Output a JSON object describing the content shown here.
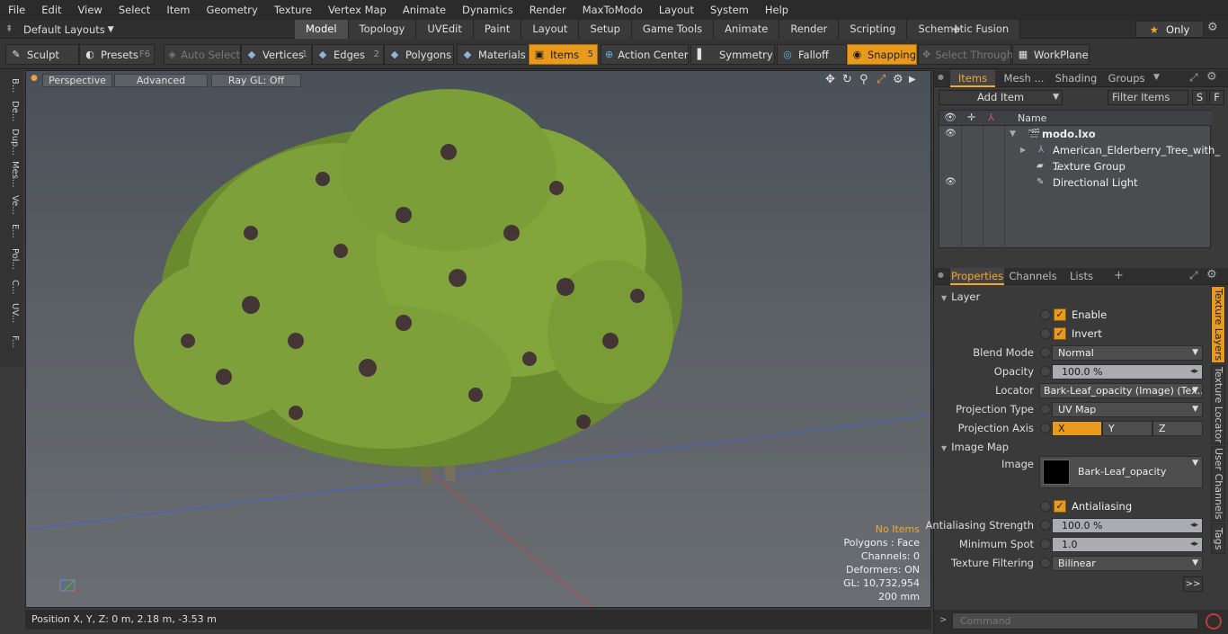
{
  "menu": [
    "File",
    "Edit",
    "View",
    "Select",
    "Item",
    "Geometry",
    "Texture",
    "Vertex Map",
    "Animate",
    "Dynamics",
    "Render",
    "MaxToModo",
    "Layout",
    "System",
    "Help"
  ],
  "layout": {
    "label": "Default Layouts"
  },
  "tabs": [
    "Model",
    "Topology",
    "UVEdit",
    "Paint",
    "Layout",
    "Setup",
    "Game Tools",
    "Animate",
    "Render",
    "Scripting",
    "Schematic Fusion"
  ],
  "active_tab": "Model",
  "only_label": "Only",
  "toolbar": {
    "sculpt": "Sculpt",
    "presets": "Presets",
    "presets_key": "F6",
    "auto_select": "Auto Select",
    "vertices": "Vertices",
    "vertices_count": "1",
    "edges": "Edges",
    "edges_count": "2",
    "polygons": "Polygons",
    "materials": "Materials",
    "items": "Items",
    "items_count": "5",
    "action_center": "Action Center",
    "symmetry": "Symmetry",
    "falloff": "Falloff",
    "snapping": "Snapping",
    "select_through": "Select Through",
    "workplane": "WorkPlane"
  },
  "left_tabs": [
    "B...",
    "De...",
    "Dup...",
    "Mes...",
    "Ve...",
    "E...",
    "Pol...",
    "C...",
    "UV...",
    "F..."
  ],
  "viewport": {
    "perspective": "Perspective",
    "advanced": "Advanced",
    "raygl": "Ray GL: Off",
    "stats": {
      "no_items": "No Items",
      "polygons": "Polygons : Face",
      "channels": "Channels: 0",
      "deformers": "Deformers: ON",
      "gl": "GL: 10,732,954",
      "scale": "200 mm"
    }
  },
  "status": {
    "position": "Position X, Y, Z:   0 m, 2.18 m, -3.53 m"
  },
  "items_panel": {
    "tabs": [
      "Items",
      "Mesh ...",
      "Shading",
      "Groups"
    ],
    "add_item": "Add Item",
    "filter": "Filter Items",
    "s_btn": "S",
    "f_btn": "F",
    "name_header": "Name",
    "rows": [
      "modo.lxo",
      "American_Elderberry_Tree_with_ ...",
      "Texture Group",
      "Directional Light"
    ]
  },
  "properties_panel": {
    "tabs": [
      "Properties",
      "Channels",
      "Lists"
    ],
    "layer_section": "Layer",
    "enable": "Enable",
    "invert": "Invert",
    "blend_mode_label": "Blend Mode",
    "blend_mode": "Normal",
    "opacity_label": "Opacity",
    "opacity": "100.0 %",
    "locator_label": "Locator",
    "locator": "Bark-Leaf_opacity (Image) (Tex...",
    "projection_type_label": "Projection Type",
    "projection_type": "UV Map",
    "projection_axis_label": "Projection Axis",
    "axis_x": "X",
    "axis_y": "Y",
    "axis_z": "Z",
    "image_map_section": "Image Map",
    "image_label": "Image",
    "image_name": "Bark-Leaf_opacity",
    "antialiasing": "Antialiasing",
    "aa_strength_label": "Antialiasing Strength",
    "aa_strength": "100.0 %",
    "min_spot_label": "Minimum Spot",
    "min_spot": "1.0",
    "tex_filter_label": "Texture Filtering",
    "tex_filter": "Bilinear",
    "more": ">>"
  },
  "vertical_tabs": [
    "Texture Layers",
    "Texture Locator",
    "User Channels",
    "Tags"
  ],
  "command": {
    "placeholder": "Command"
  },
  "colors": {
    "accent": "#e89a1c",
    "panel": "#3a3a3a"
  }
}
